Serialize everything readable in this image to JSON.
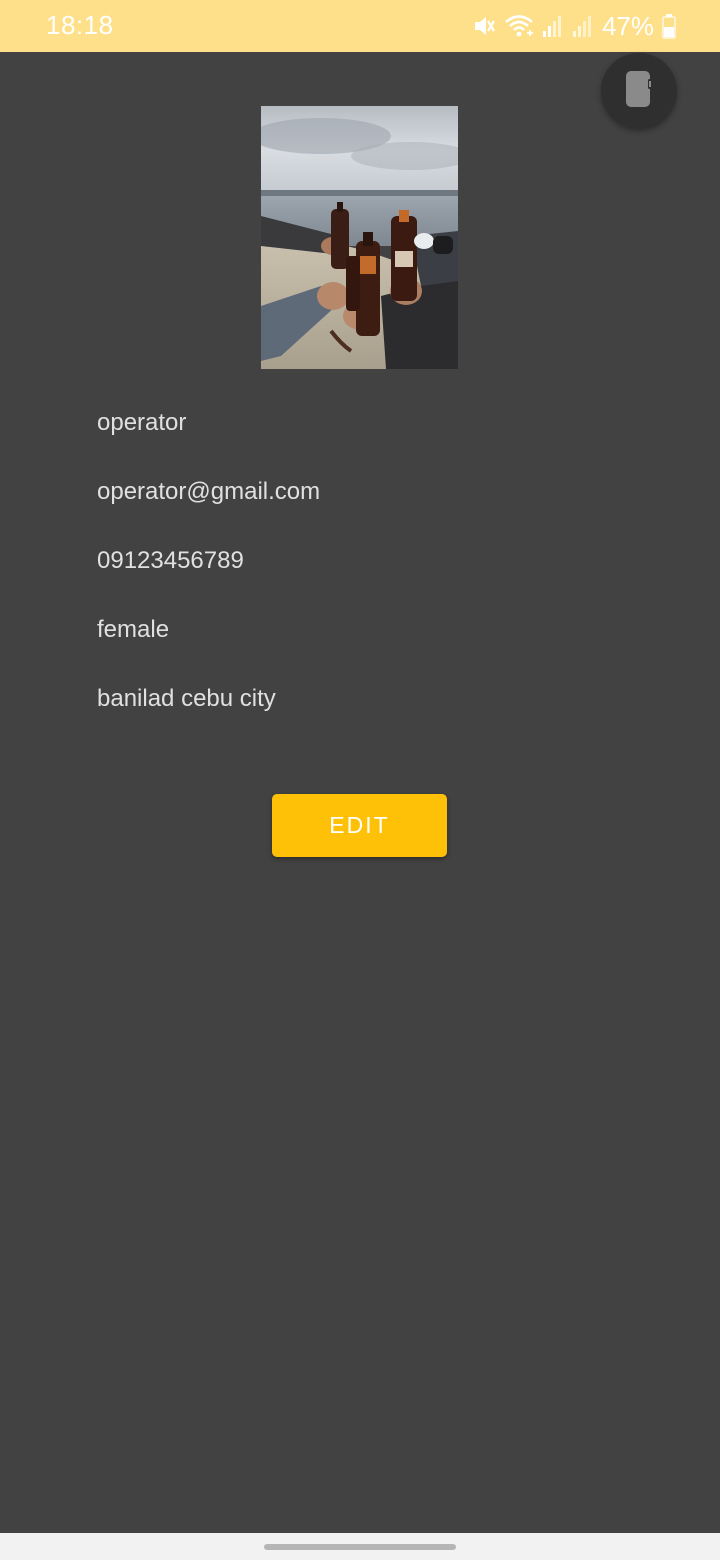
{
  "status_bar": {
    "time": "18:18",
    "battery_percent": "47%",
    "icons": [
      "mute-icon",
      "wifi-icon",
      "signal-icon",
      "signal-icon",
      "battery-icon"
    ],
    "background_color": "#ffe08a"
  },
  "floating_button": {
    "icon": "phone-rotate-icon"
  },
  "profile": {
    "photo_description_icon": "profile-photo",
    "username": "operator",
    "email": "operator@gmail.com",
    "phone": "09123456789",
    "gender": "female",
    "address": "banilad cebu city"
  },
  "actions": {
    "edit_label": "EDIT",
    "edit_color": "#ffc107"
  },
  "theme": {
    "background": "#424242",
    "text": "#e0e0e0"
  }
}
